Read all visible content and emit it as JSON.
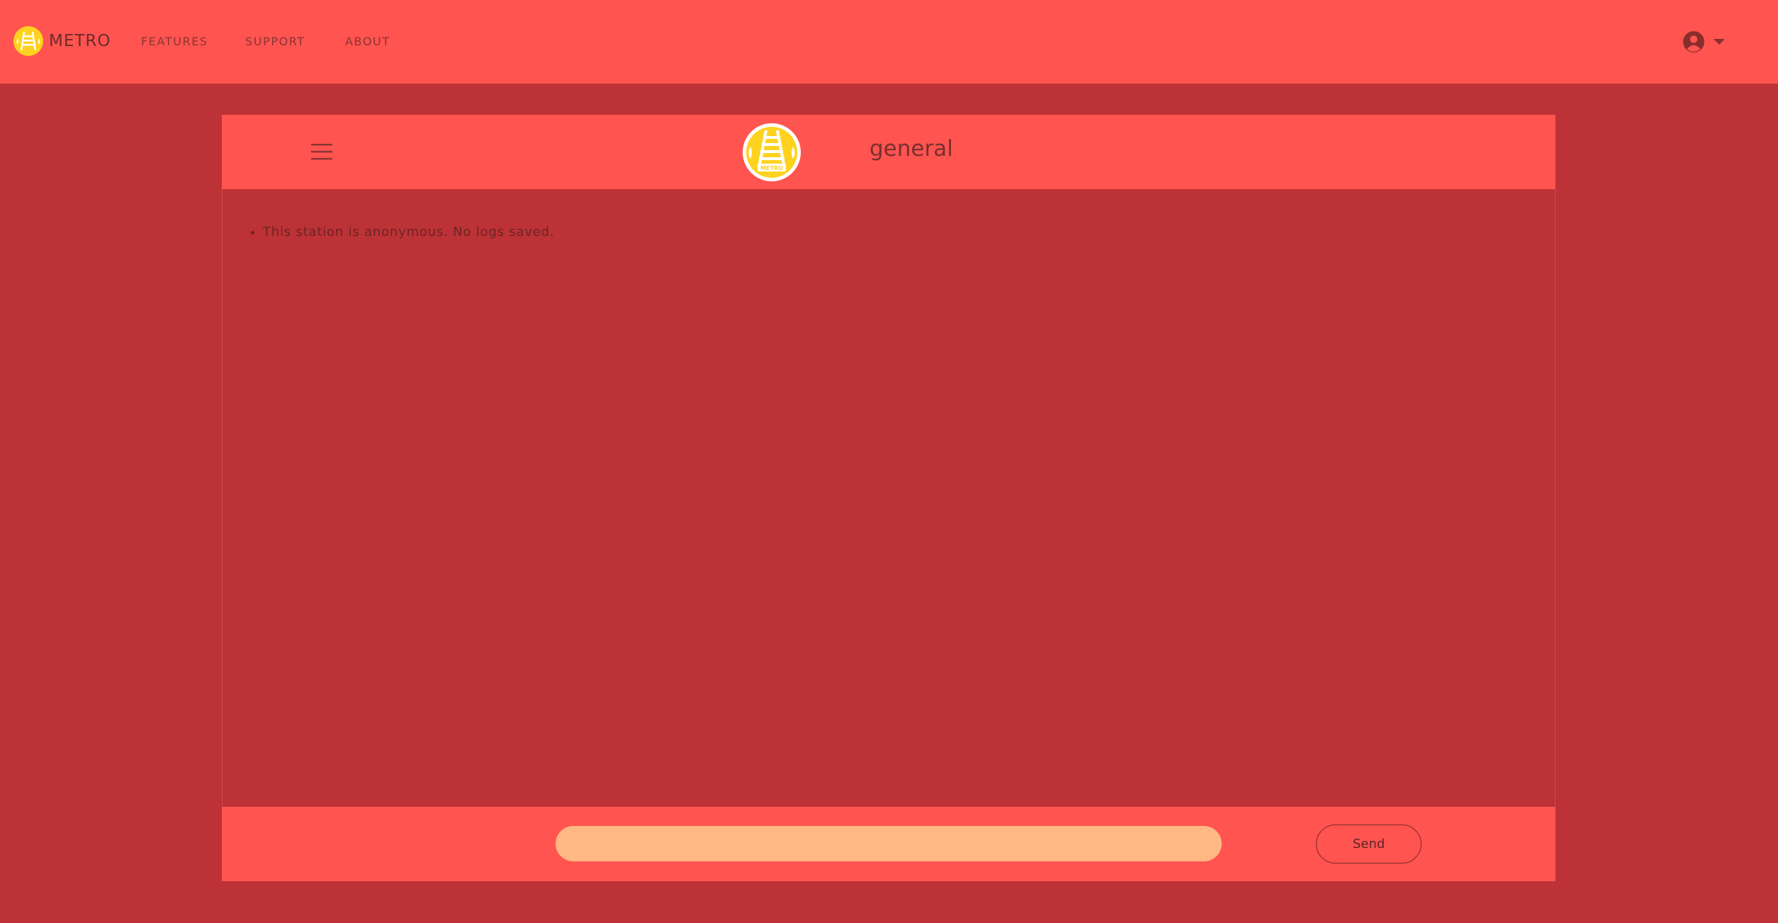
{
  "nav": {
    "brand": "METRO",
    "links": {
      "features": "FEATURES",
      "support": "SUPPORT",
      "about": "ABOUT"
    },
    "user_icon": "user-circle-icon",
    "user_caret_icon": "caret-down-icon"
  },
  "chat": {
    "menu_icon": "hamburger-menu-icon",
    "room_logo_icon": "metro-rail-logo-icon",
    "room_logo_text": "METRO",
    "room_name": "general",
    "messages": [
      "This station is anonymous. No logs saved."
    ],
    "input": {
      "value": "",
      "placeholder": ""
    },
    "send_label": "Send"
  },
  "colors": {
    "page_background": "#bd3236",
    "bar_background": "#ff5450",
    "input_background": "#ffb783",
    "logo_yellow": "#ffd21f",
    "logo_white": "#ffffff"
  }
}
